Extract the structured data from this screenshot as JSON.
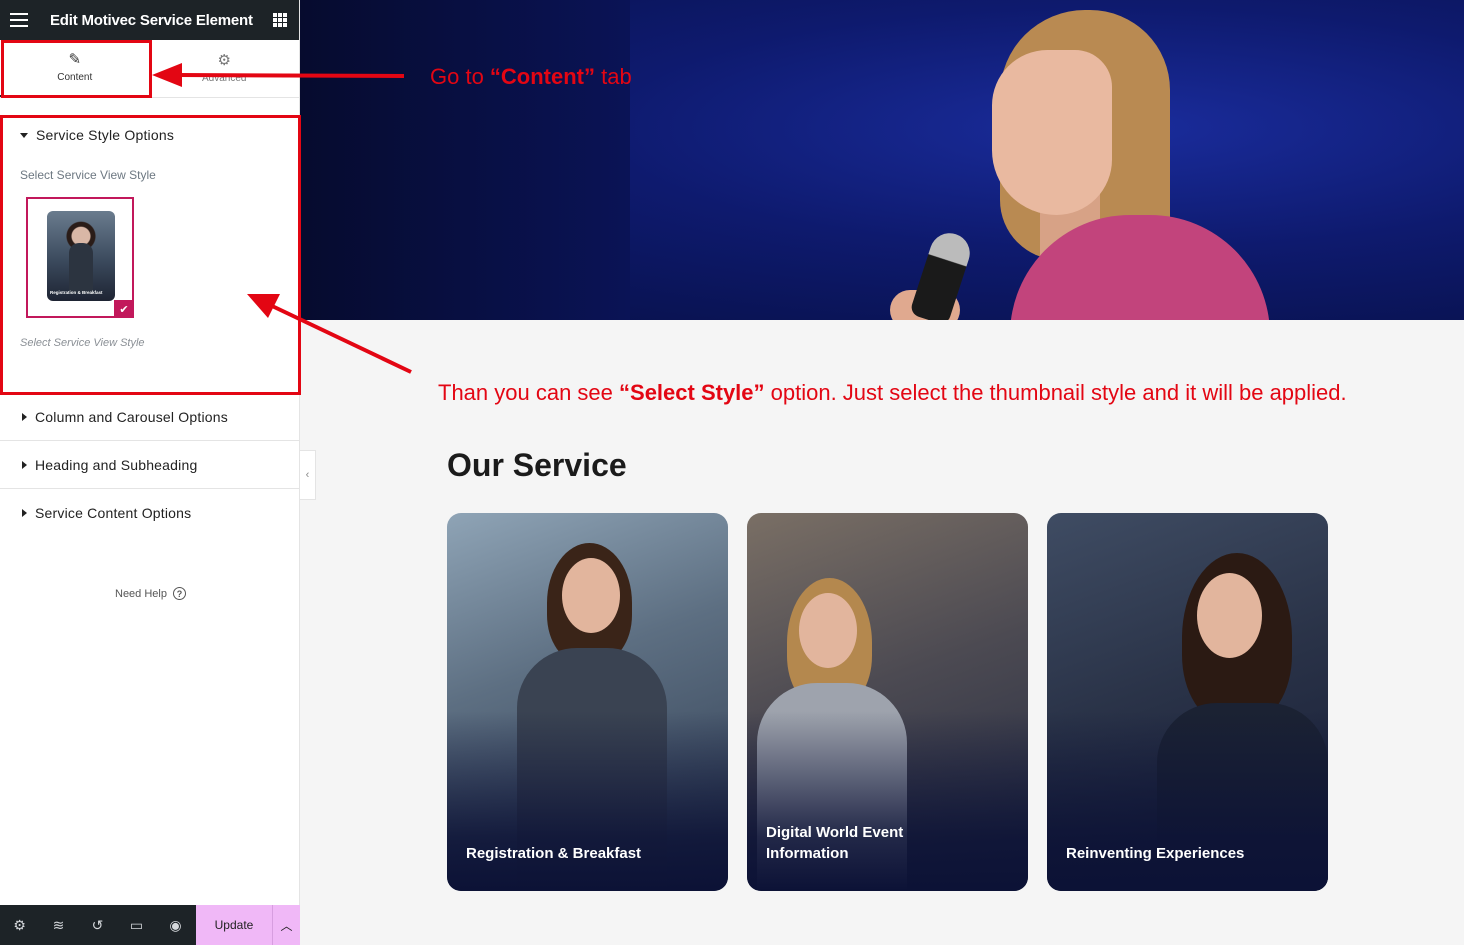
{
  "sidebar": {
    "title": "Edit Motivec Service Element",
    "tabs": [
      {
        "label": "Content",
        "icon": "pencil-icon"
      },
      {
        "label": "Advanced",
        "icon": "gear-icon"
      }
    ],
    "open_section": {
      "label": "Service Style Options",
      "control_label": "Select Service View Style",
      "thumbnail_caption": "Registration & Breakfast",
      "control_description": "Select Service View Style"
    },
    "sections": [
      {
        "label": "Column and Carousel Options"
      },
      {
        "label": "Heading and Subheading"
      },
      {
        "label": "Service Content Options"
      }
    ],
    "need_help": "Need Help",
    "footer": {
      "update_label": "Update",
      "icons": [
        "settings-icon",
        "layers-icon",
        "history-icon",
        "responsive-icon",
        "preview-icon",
        "chevron-up-icon"
      ]
    }
  },
  "annotations": {
    "note1": {
      "prefix": "Go  to ",
      "bold": "“Content”",
      "suffix": " tab"
    },
    "note2": {
      "prefix": "Than you can see ",
      "bold": "“Select Style”",
      "suffix": " option. Just select the thumbnail style and it will be applied."
    },
    "color": "#e30613"
  },
  "main": {
    "heading": "Our Service",
    "cards": [
      {
        "caption": "Registration & Breakfast"
      },
      {
        "caption": "Digital World Event\nInformation"
      },
      {
        "caption": "Reinventing Experiences"
      }
    ]
  },
  "colors": {
    "accent": "#c2185b",
    "update_button": "#f0b8f7",
    "topbar": "#1d2327"
  }
}
